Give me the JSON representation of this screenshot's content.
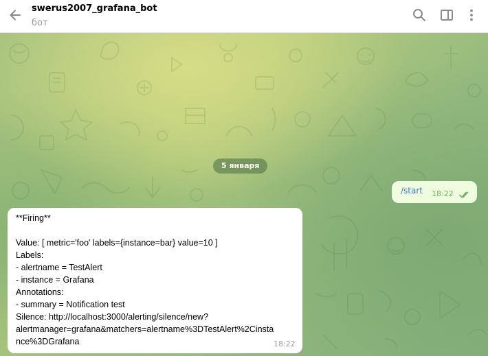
{
  "header": {
    "title": "swerus2007_grafana_bot",
    "subtitle": "бот",
    "icons": [
      "arrow-left-icon",
      "search-icon",
      "sidebar-panel-icon",
      "more-vertical-icon"
    ]
  },
  "chat": {
    "date_divider": "5 января",
    "outgoing": {
      "text": "/start",
      "time": "18:22",
      "status": "read"
    },
    "incoming": {
      "lines": [
        "**Firing**",
        "",
        "Value: [ metric='foo' labels={instance=bar} value=10 ]",
        "Labels:",
        " - alertname = TestAlert",
        " - instance = Grafana",
        "Annotations:",
        " - summary = Notification test",
        "Silence: http://localhost:3000/alerting/silence/new?",
        "alertmanager=grafana&matchers=alertname%3DTestAlert%2Cinsta",
        "nce%3DGrafana"
      ],
      "time": "18:22"
    }
  },
  "colors": {
    "link": "#3a7cc4",
    "outgoing_bubble": "#effdde",
    "incoming_bubble": "#ffffff",
    "read_checks": "#6fae64",
    "date_pill": "#4a6e42",
    "header_icons": "#8a8a8a"
  }
}
